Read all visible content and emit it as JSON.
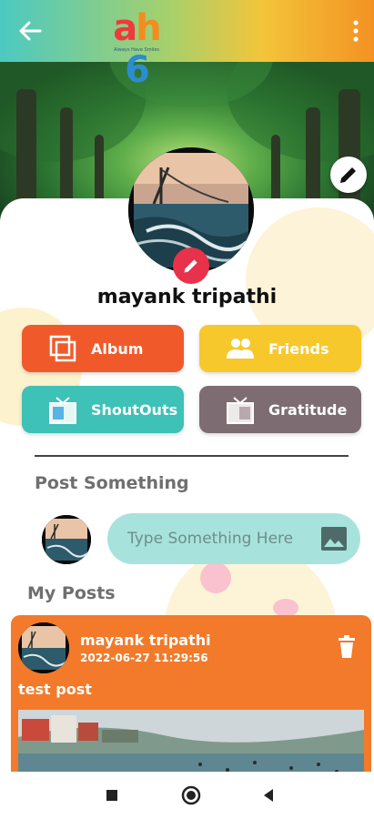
{
  "app": {
    "logo_text": "ah6",
    "logo_subtitle": "Always Have Smiles"
  },
  "profile": {
    "name": "mayank tripathi"
  },
  "actions": {
    "album": "Album",
    "friends": "Friends",
    "shoutouts": "ShoutOuts",
    "gratitude": "Gratitude"
  },
  "composer": {
    "section_title": "Post Something",
    "placeholder": "Type Something Here"
  },
  "posts": {
    "section_title": "My Posts",
    "items": [
      {
        "author": "mayank tripathi",
        "timestamp": "2022-06-27 11:29:56",
        "text": "test post"
      }
    ]
  },
  "colors": {
    "album": "#f05a2b",
    "friends": "#f6c82b",
    "shoutouts": "#3ec1b6",
    "gratitude": "#7d6d72",
    "post_card": "#f27a2a",
    "edit_badge": "#e8314b"
  },
  "icons": {
    "back": "arrow-left-icon",
    "menu": "more-vertical-icon",
    "edit": "pencil-icon",
    "album": "album-stack-icon",
    "friends": "people-icon",
    "shoutouts": "shoutout-box-icon",
    "gratitude": "gratitude-box-icon",
    "image": "image-icon",
    "delete": "trash-icon"
  }
}
